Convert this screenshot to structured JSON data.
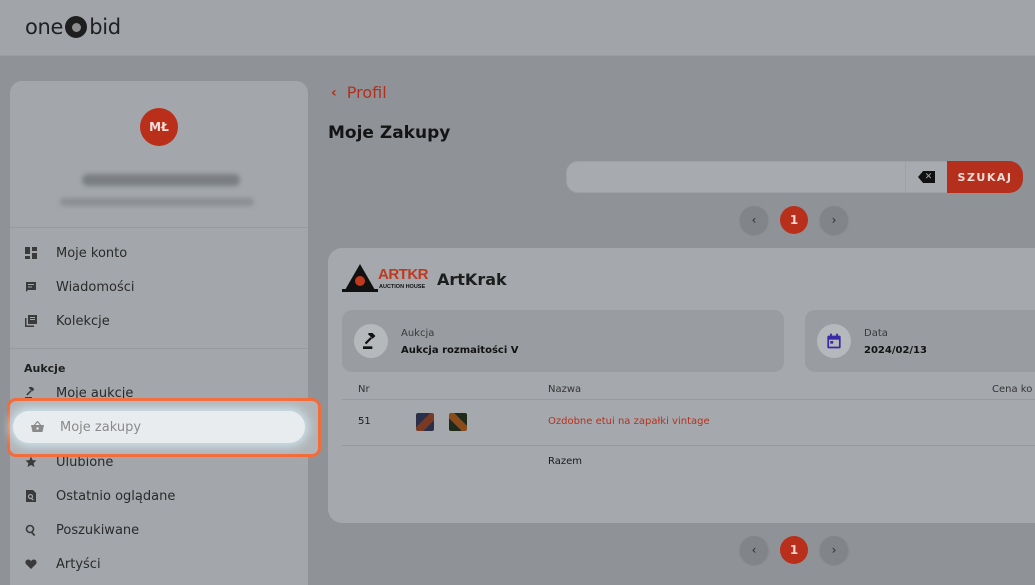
{
  "header": {
    "logo_left": "one",
    "logo_right": "bid"
  },
  "sidebar": {
    "avatar_initials": "MŁ",
    "nav": [
      {
        "label": "Moje konto",
        "icon": "dashboard-icon"
      },
      {
        "label": "Wiadomości",
        "icon": "message-icon"
      },
      {
        "label": "Kolekcje",
        "icon": "collection-icon"
      }
    ],
    "section_label": "Aukcje",
    "auction_nav": [
      {
        "label": "Moje aukcje",
        "icon": "gavel-icon"
      },
      {
        "label": "Moje zakupy",
        "icon": "basket-icon",
        "active": true
      },
      {
        "label": "Ulubione",
        "icon": "star-icon"
      },
      {
        "label": "Ostatnio oglądane",
        "icon": "viewed-icon"
      },
      {
        "label": "Poszukiwane",
        "icon": "search-icon"
      },
      {
        "label": "Artyści",
        "icon": "heart-icon"
      }
    ]
  },
  "main": {
    "back_label": "Profil",
    "title": "Moje Zakupy",
    "search": {
      "value": "",
      "button_label": "SZUKAJ"
    },
    "pagination": {
      "current": "1",
      "prev": "‹",
      "next": "›"
    },
    "auction_house": {
      "logo_text": "ARTKRAK",
      "logo_subtext": "AUCTION HOUSE",
      "name": "ArtKrak",
      "auction_label": "Aukcja",
      "auction_value": "Aukcja rozmaitości V",
      "date_label": "Data",
      "date_value": "2024/02/13"
    },
    "table": {
      "headers": {
        "nr": "Nr",
        "name": "Nazwa",
        "price": "Cena ko"
      },
      "rows": [
        {
          "nr": "51",
          "name": "Ozdobne etui na zapałki vintage"
        }
      ],
      "total_label": "Razem"
    }
  },
  "colors": {
    "accent": "#b4301c",
    "highlight": "#f26b3b"
  }
}
